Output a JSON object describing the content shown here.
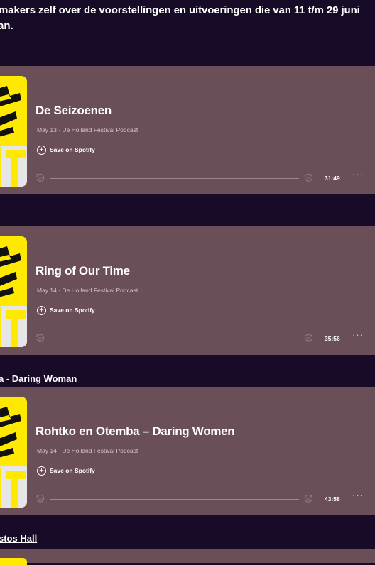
{
  "intro": {
    "line1": "makers zelf over de voorstellingen en uitvoeringen die van 11 t/m 29 juni",
    "line2": "taan."
  },
  "episodes": [
    {
      "title": "De Seizoenen",
      "meta": "May 13 · De Holland Festival Podcast",
      "save_label": "Save on Spotify",
      "duration": "31:49",
      "progress": 0,
      "skip_back": "15",
      "skip_forward": "15",
      "more": "···"
    },
    {
      "title": "Ring of Our Time",
      "meta": "May 14 · De Holland Festival Podcast",
      "save_label": "Save on Spotify",
      "duration": "35:56",
      "progress": 0,
      "skip_back": "15",
      "skip_forward": "15",
      "more": "···"
    },
    {
      "title": "Rohtko en Otemba – Daring Women",
      "meta": "May 14 · De Holland Festival Podcast",
      "save_label": "Save on Spotify",
      "duration": "43:58",
      "progress": 0,
      "skip_back": "15",
      "skip_forward": "15",
      "more": "···"
    }
  ],
  "links": {
    "daring_woman": "a - Daring Woman",
    "stos_hall": "stos Hall"
  },
  "colors": {
    "page_bg": "#170b27",
    "card_bg": "#6a4f59",
    "cover_yellow": "#ffe900",
    "meta_text": "#d9c3cb"
  }
}
